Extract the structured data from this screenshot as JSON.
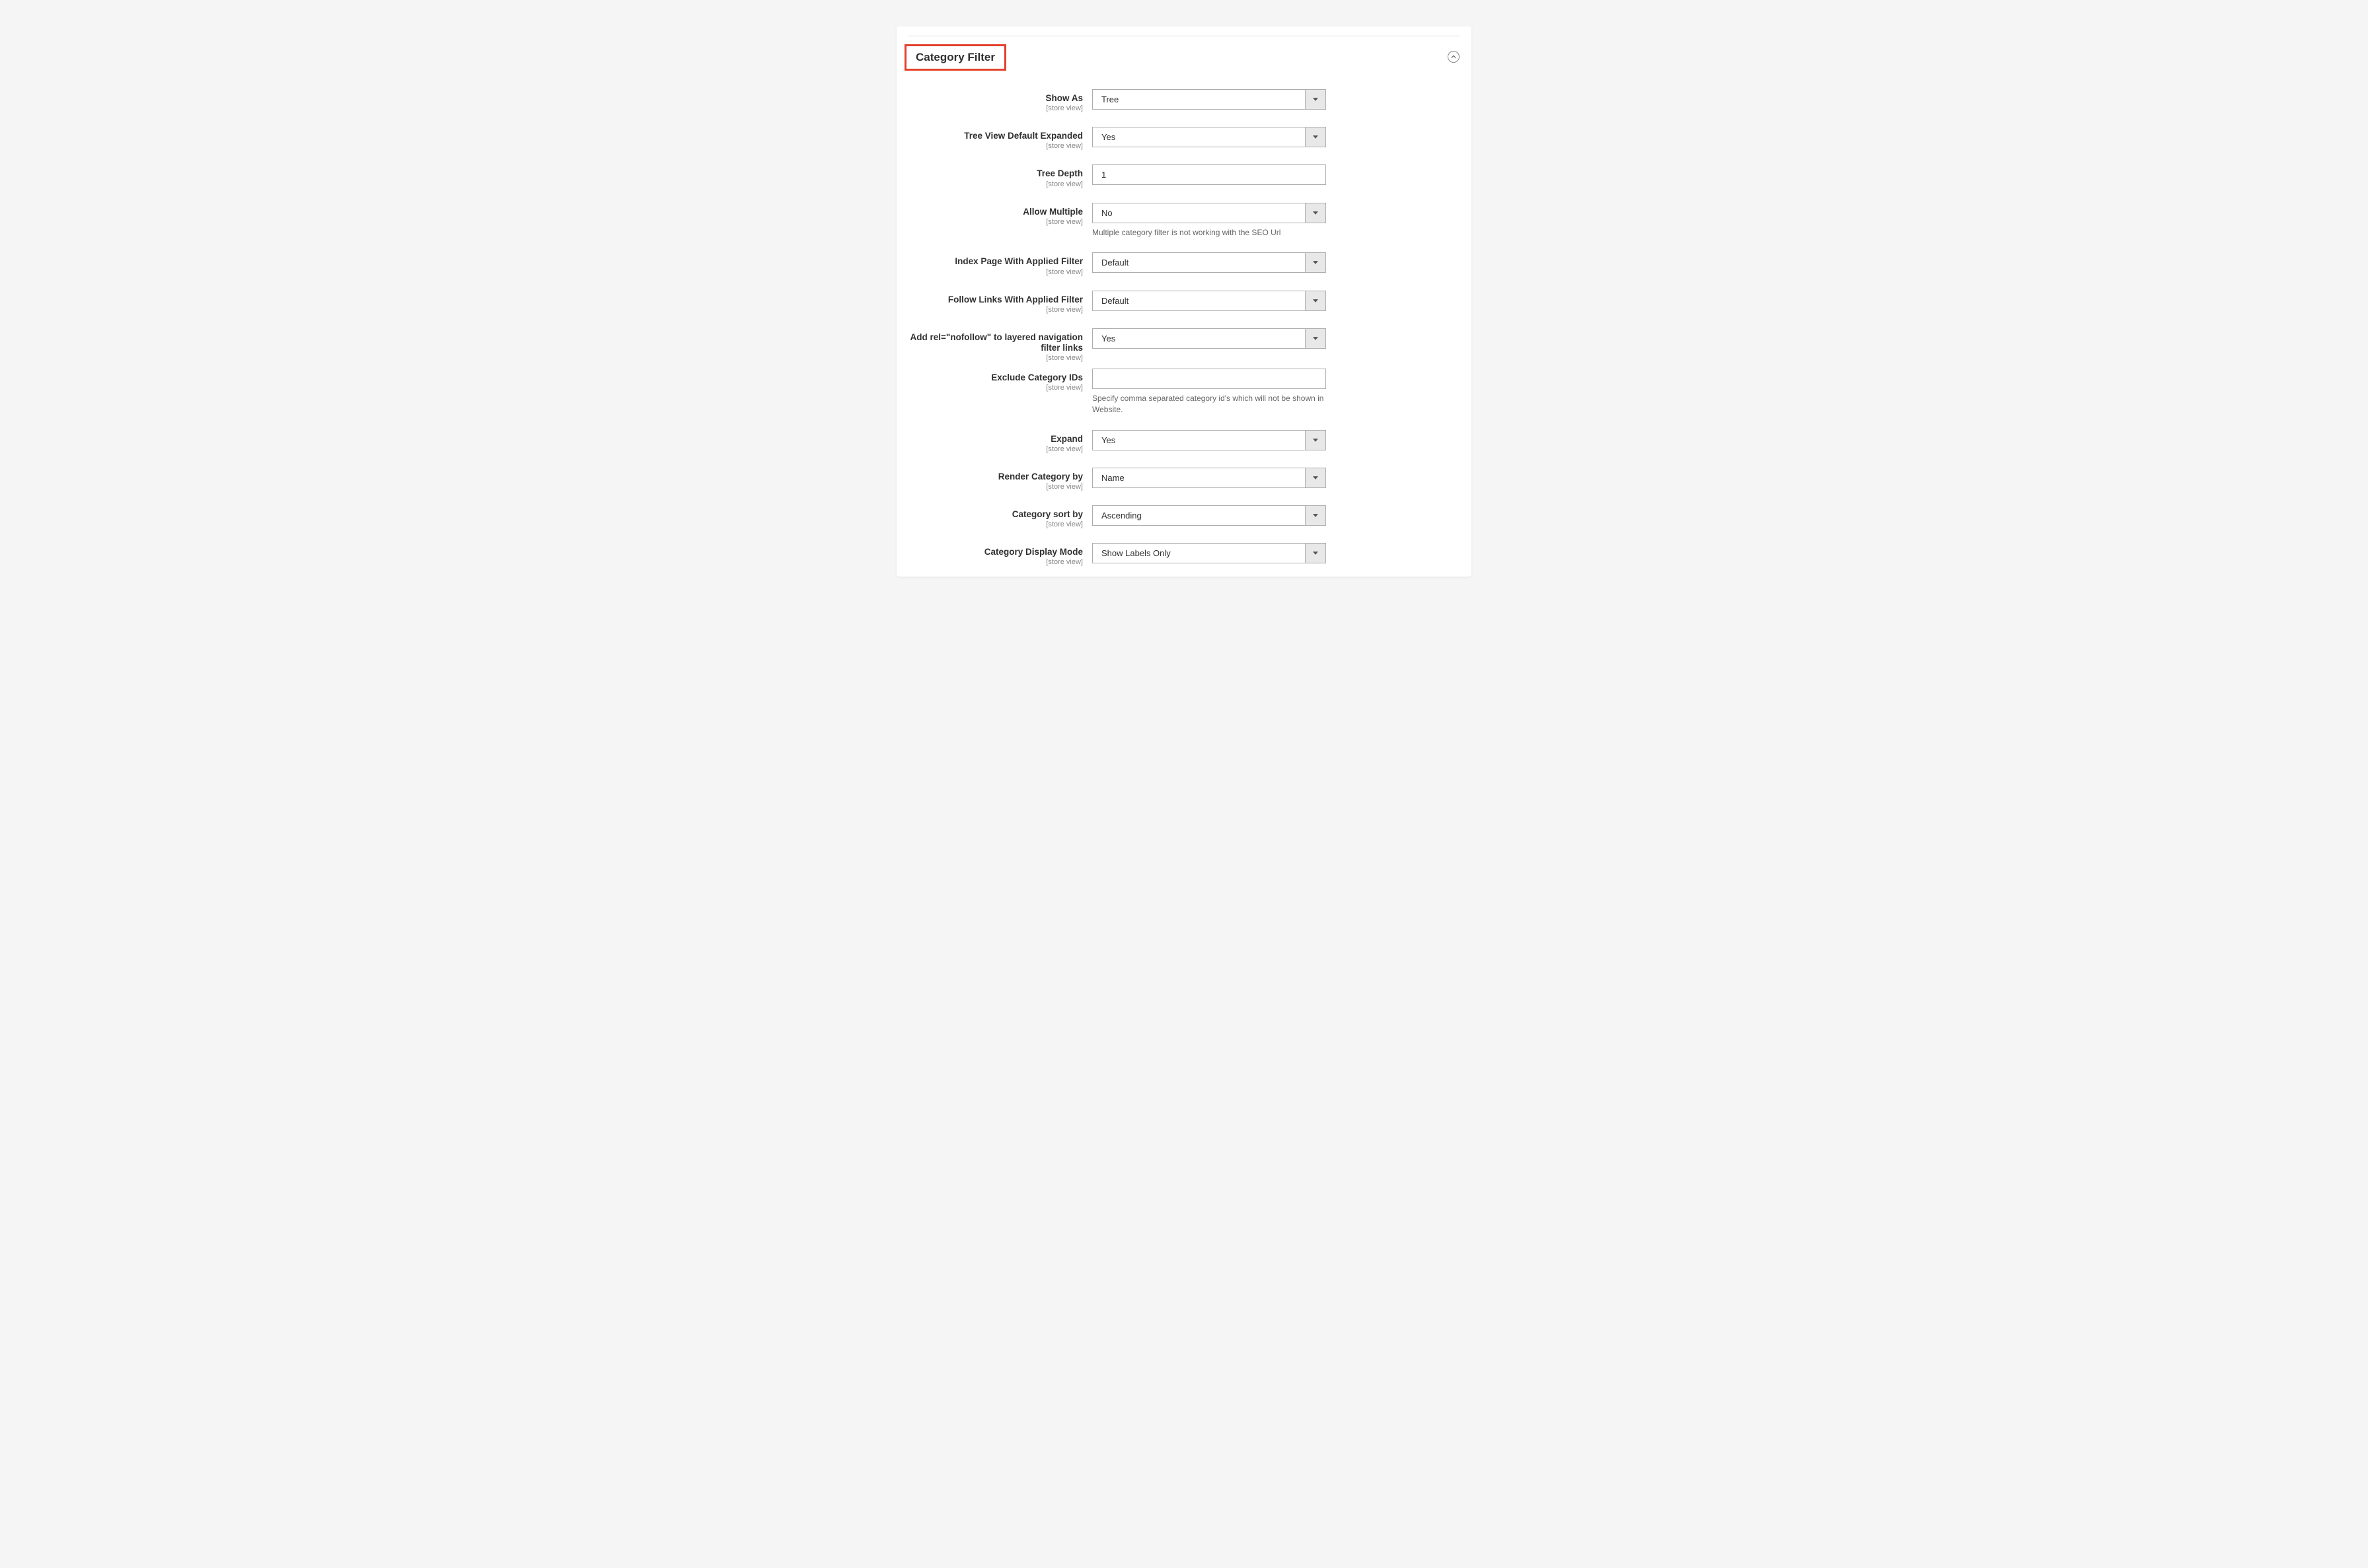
{
  "section": {
    "title": "Category Filter",
    "scope_label": "[store view]"
  },
  "fields": {
    "show_as": {
      "label": "Show As",
      "value": "Tree"
    },
    "tree_expanded": {
      "label": "Tree View Default Expanded",
      "value": "Yes"
    },
    "tree_depth": {
      "label": "Tree Depth",
      "value": "1"
    },
    "allow_multiple": {
      "label": "Allow Multiple",
      "value": "No",
      "note": "Multiple category filter is not working with the SEO Url"
    },
    "index_page": {
      "label": "Index Page With Applied Filter",
      "value": "Default"
    },
    "follow_links": {
      "label": "Follow Links With Applied Filter",
      "value": "Default"
    },
    "nofollow": {
      "label": "Add rel=\"nofollow\" to layered navigation filter links",
      "value": "Yes"
    },
    "exclude_ids": {
      "label": "Exclude Category IDs",
      "value": "",
      "note": "Specify comma separated category id's which will not be shown in Website."
    },
    "expand": {
      "label": "Expand",
      "value": "Yes"
    },
    "render_by": {
      "label": "Render Category by",
      "value": "Name"
    },
    "sort_by": {
      "label": "Category sort by",
      "value": "Ascending"
    },
    "display_mode": {
      "label": "Category Display Mode",
      "value": "Show Labels Only"
    }
  }
}
